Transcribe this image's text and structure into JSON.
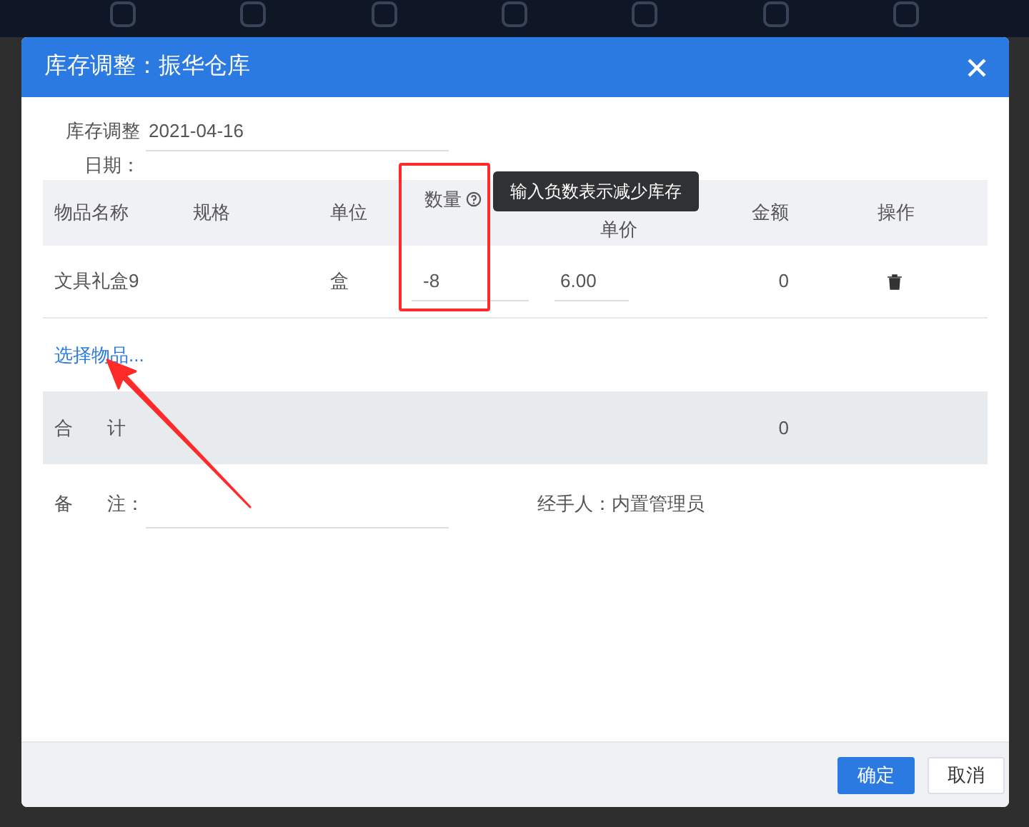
{
  "dialog": {
    "title": "库存调整：振华仓库",
    "date_label": "库存调整日期：",
    "date_value": "2021-04-16"
  },
  "table": {
    "columns": [
      "物品名称",
      "规格",
      "单位",
      "数量",
      "单价",
      "金额",
      "操作"
    ],
    "rows": [
      {
        "name": "文具礼盒9",
        "unit": "盒",
        "quantity": "-8",
        "price": "6.00",
        "amount": "0"
      }
    ],
    "tooltip": "输入负数表示减少库存"
  },
  "select_link": "选择物品...",
  "total": {
    "label_1": "合",
    "label_2": "计",
    "amount": "0"
  },
  "remark": {
    "label_1": "备",
    "label_2": "注："
  },
  "handler": {
    "label": "经手人：",
    "value": "内置管理员"
  },
  "buttons": [
    {
      "label": "确定",
      "kind": "primary"
    },
    {
      "label": "取消",
      "kind": "secondary"
    }
  ]
}
